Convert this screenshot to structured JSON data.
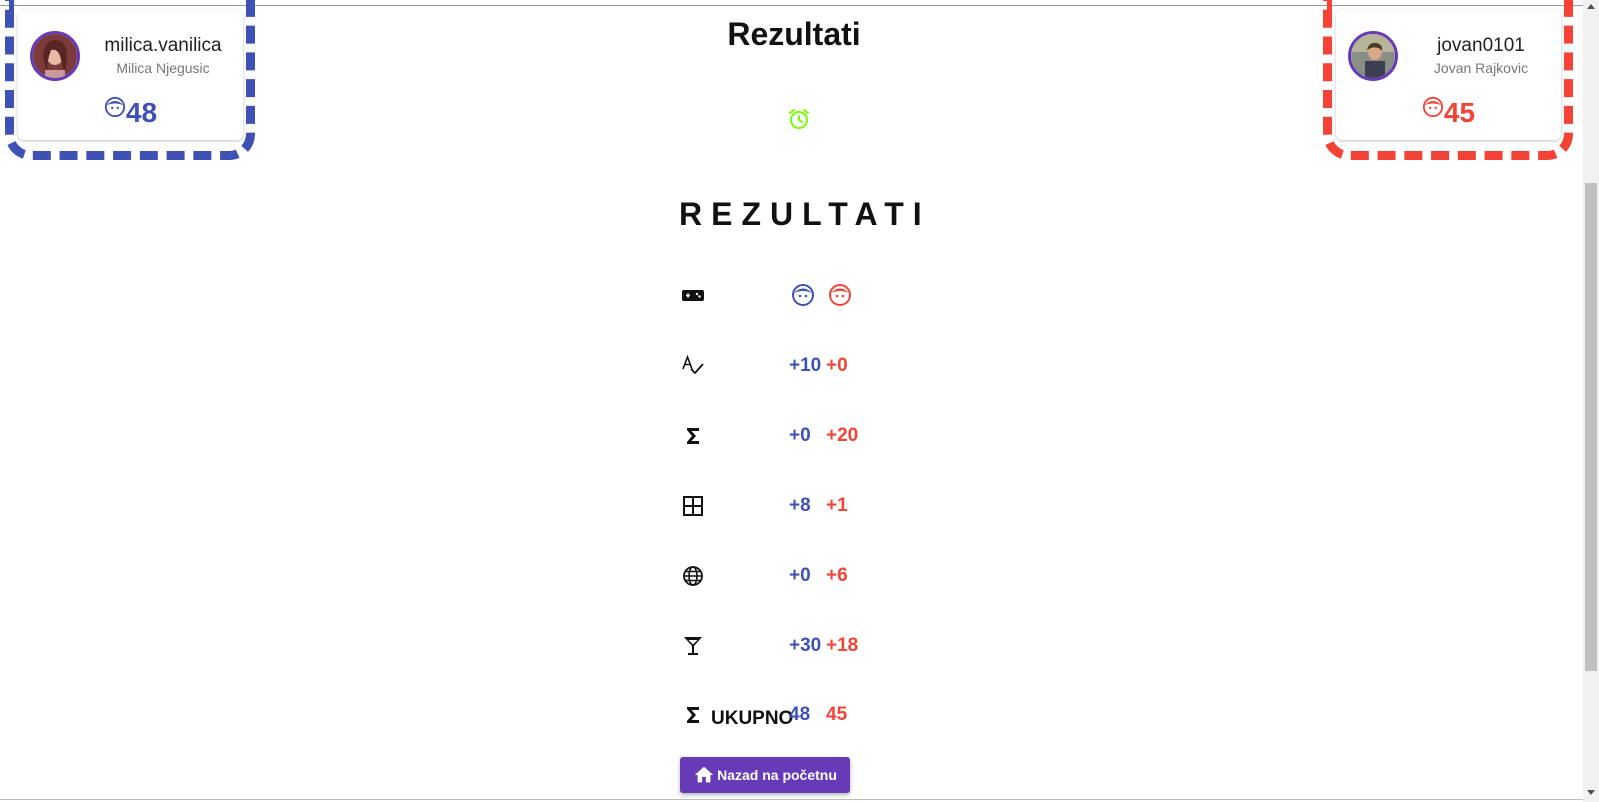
{
  "page": {
    "title": "Rezultati"
  },
  "colors": {
    "player1": "#3f51b5",
    "player2": "#f44336",
    "accent": "#673ab7",
    "timer": "#76ff03"
  },
  "players": [
    {
      "username": "milica.vanilica",
      "fullname": "Milica Njegusic",
      "score": "48",
      "icon": "face-icon",
      "color": "#3f51b5"
    },
    {
      "username": "jovan0101",
      "fullname": "Jovan Rajkovic",
      "score": "45",
      "icon": "face-icon",
      "color": "#f44336"
    }
  ],
  "timer": {
    "icon": "alarm-clock-icon"
  },
  "results": {
    "heading": "REZULTATI",
    "header_icons": [
      "gamepad-icon",
      "face-icon-blue",
      "face-icon-red"
    ],
    "rows": [
      {
        "icon": "spellcheck-icon",
        "p1": "+10",
        "p2": "+0"
      },
      {
        "icon": "sigma-icon",
        "p1": "+0",
        "p2": "+20"
      },
      {
        "icon": "grid-icon",
        "p1": "+8",
        "p2": "+1"
      },
      {
        "icon": "globe-icon",
        "p1": "+0",
        "p2": "+6"
      },
      {
        "icon": "cocktail-icon",
        "p1": "+30",
        "p2": "+18"
      }
    ],
    "total": {
      "icon": "sigma-icon",
      "label": "UKUPNO",
      "p1": "48",
      "p2": "45"
    }
  },
  "home_button": {
    "label": "Nazad na početnu",
    "icon": "home-icon"
  }
}
